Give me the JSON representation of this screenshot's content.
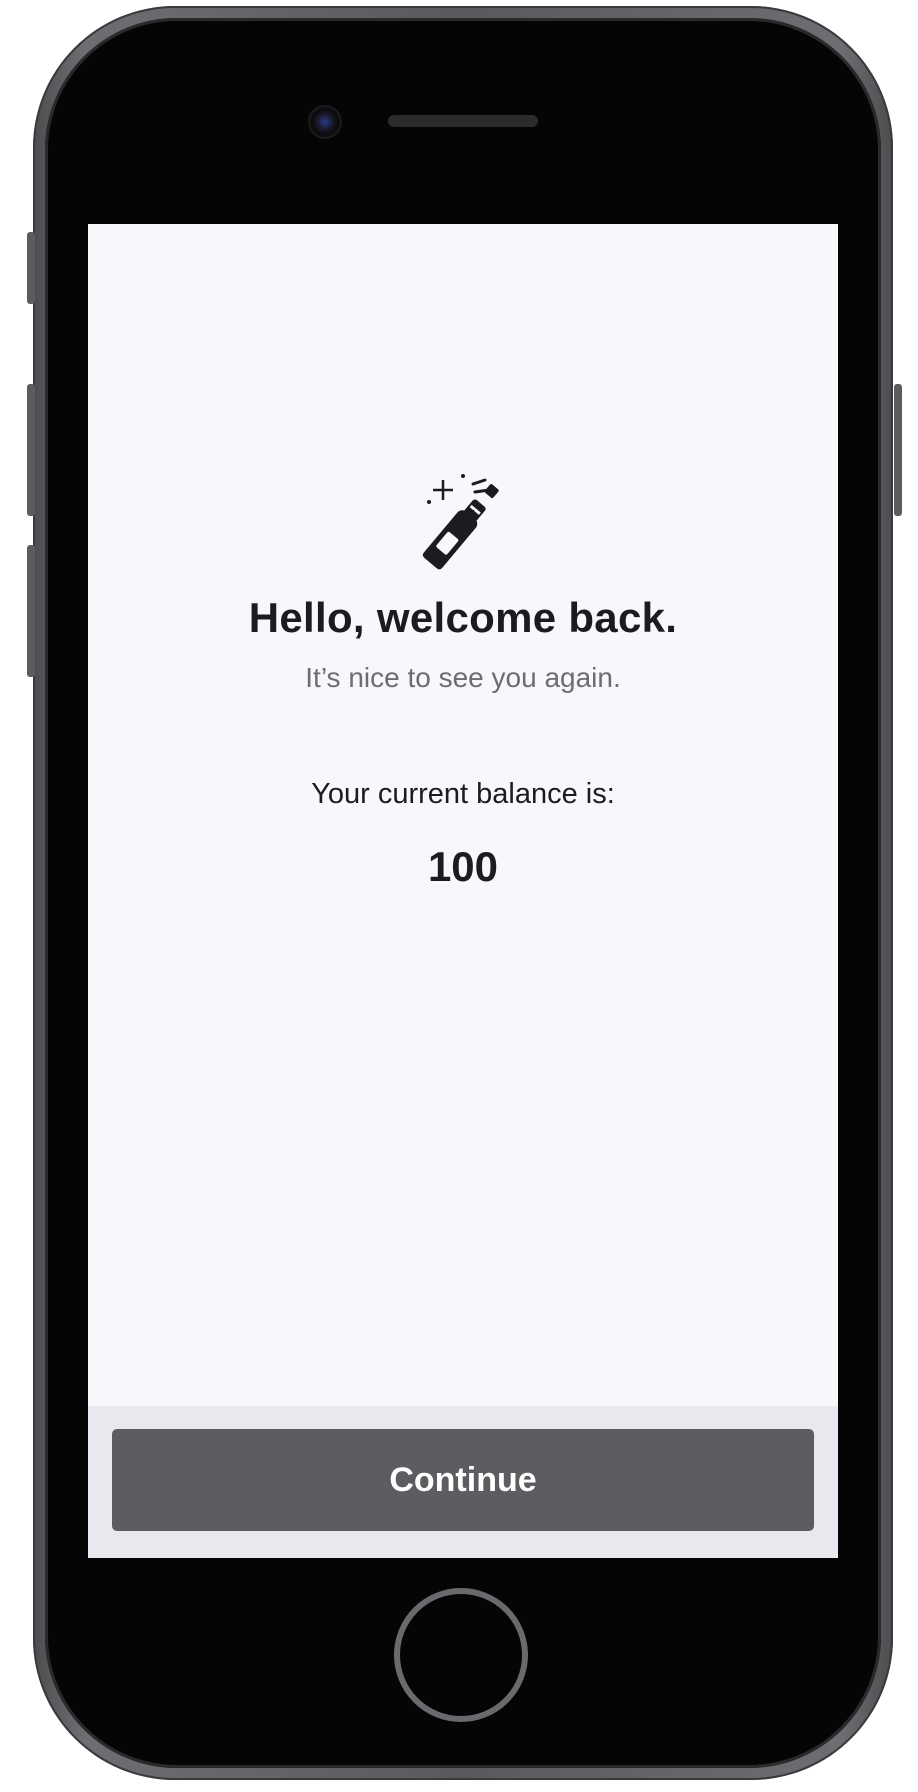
{
  "welcome": {
    "icon": "champagne-bottle-icon",
    "title": "Hello, welcome back.",
    "subtitle": "It’s nice to see you again."
  },
  "balance": {
    "label": "Your current balance is:",
    "value": "100"
  },
  "footer": {
    "continue_label": "Continue"
  },
  "colors": {
    "screen_background": "#f7f8fb",
    "footer_background": "#e8e9ee",
    "button_background": "#5c5d61",
    "button_text": "#ffffff",
    "title_text": "#1b1c20",
    "subtitle_text": "#6b6d72"
  }
}
